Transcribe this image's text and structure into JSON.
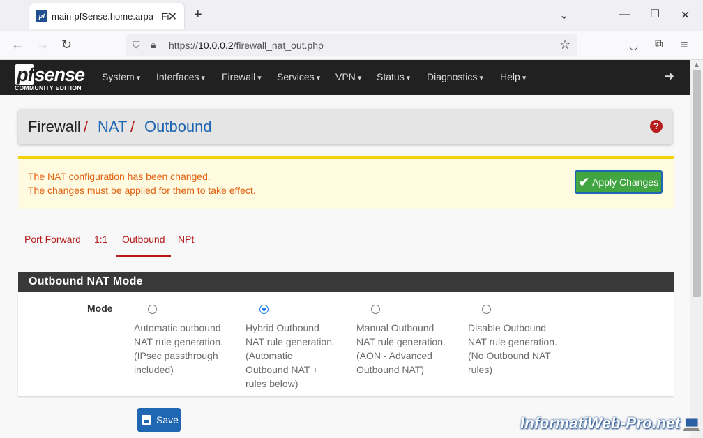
{
  "browser": {
    "tab_title": "main-pfSense.home.arpa - Fire",
    "favicon_text": "pf",
    "url_prefix": "https://",
    "url_host": "10.0.0.2",
    "url_path": "/firewall_nat_out.php"
  },
  "header": {
    "logo_pf": "pf",
    "logo_sense": "sense",
    "logo_edition": "COMMUNITY EDITION",
    "menu": [
      "System",
      "Interfaces",
      "Firewall",
      "Services",
      "VPN",
      "Status",
      "Diagnostics",
      "Help"
    ]
  },
  "breadcrumb": {
    "items": [
      "Firewall",
      "NAT",
      "Outbound"
    ],
    "separator": "/"
  },
  "alert": {
    "line1": "The NAT configuration has been changed.",
    "line2": "The changes must be applied for them to take effect.",
    "apply_label": "Apply Changes"
  },
  "tabs": [
    "Port Forward",
    "1:1",
    "Outbound",
    "NPt"
  ],
  "active_tab": "Outbound",
  "panel": {
    "title": "Outbound NAT Mode",
    "mode_label": "Mode",
    "options": [
      {
        "lines": [
          "Automatic outbound",
          "NAT rule generation.",
          "(IPsec passthrough",
          "included)"
        ],
        "selected": false
      },
      {
        "lines": [
          "Hybrid Outbound",
          "NAT rule generation.",
          "(Automatic",
          "Outbound NAT +",
          "rules below)"
        ],
        "selected": true
      },
      {
        "lines": [
          "Manual Outbound",
          "NAT rule generation.",
          "(AON - Advanced",
          "Outbound NAT)"
        ],
        "selected": false
      },
      {
        "lines": [
          "Disable Outbound",
          "NAT rule generation.",
          "(No Outbound NAT",
          "rules)"
        ],
        "selected": false
      }
    ]
  },
  "save_label": "Save",
  "watermark": "InformatiWeb-Pro.net",
  "colors": {
    "pfsense_red": "#b71c1c",
    "link_blue": "#1f66b3",
    "apply_green": "#41a541",
    "alert_bg": "#fffbe0",
    "alert_border": "#f5d10b",
    "header_bg": "#212121"
  }
}
